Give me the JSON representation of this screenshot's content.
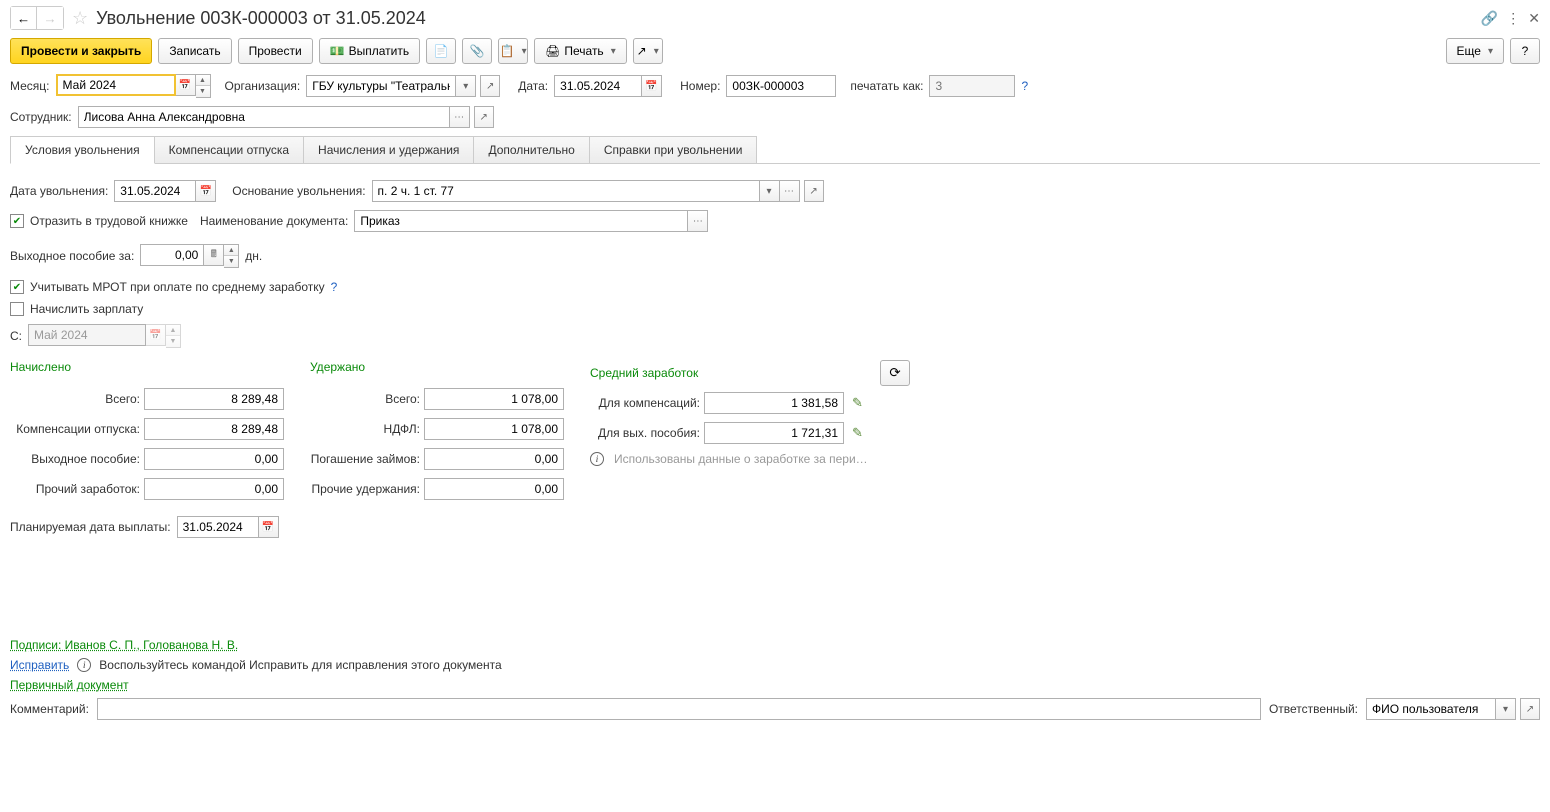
{
  "header": {
    "title": "Увольнение 00ЗК-000003 от 31.05.2024"
  },
  "toolbar": {
    "process_close": "Провести и закрыть",
    "save": "Записать",
    "process": "Провести",
    "pay": "Выплатить",
    "print": "Печать",
    "more": "Еще"
  },
  "fields": {
    "month_label": "Месяц:",
    "month_value": "Май 2024",
    "org_label": "Организация:",
    "org_value": "ГБУ культуры \"Театральны",
    "date_label": "Дата:",
    "date_value": "31.05.2024",
    "number_label": "Номер:",
    "number_value": "00ЗК-000003",
    "print_as_label": "печатать как:",
    "print_as_value": "3",
    "employee_label": "Сотрудник:",
    "employee_value": "Лисова Анна Александровна"
  },
  "tabs": {
    "conditions": "Условия увольнения",
    "vacation_comp": "Компенсации отпуска",
    "accruals": "Начисления и удержания",
    "additional": "Дополнительно",
    "certificates": "Справки при увольнении"
  },
  "conditions": {
    "dismissal_date_label": "Дата увольнения:",
    "dismissal_date_value": "31.05.2024",
    "basis_label": "Основание увольнения:",
    "basis_value": "п. 2 ч. 1 ст. 77",
    "workbook_label": "Отразить в трудовой книжке",
    "doc_name_label": "Наименование документа:",
    "doc_name_value": "Приказ",
    "severance_label": "Выходное пособие за:",
    "severance_value": "0,00",
    "severance_unit": "дн.",
    "mrot_label": "Учитывать МРОТ при оплате по среднему заработку",
    "calc_salary_label": "Начислить зарплату",
    "from_label": "С:",
    "from_value": "Май 2024"
  },
  "sections": {
    "accrued": "Начислено",
    "withheld": "Удержано",
    "avg_earnings": "Средний заработок"
  },
  "accrued": {
    "total_label": "Всего:",
    "total_value": "8 289,48",
    "vacation_label": "Компенсации отпуска:",
    "vacation_value": "8 289,48",
    "severance_label": "Выходное пособие:",
    "severance_value": "0,00",
    "other_label": "Прочий заработок:",
    "other_value": "0,00"
  },
  "withheld": {
    "total_label": "Всего:",
    "total_value": "1 078,00",
    "ndfl_label": "НДФЛ:",
    "ndfl_value": "1 078,00",
    "loans_label": "Погашение займов:",
    "loans_value": "0,00",
    "other_label": "Прочие удержания:",
    "other_value": "0,00"
  },
  "avg": {
    "comp_label": "Для компенсаций:",
    "comp_value": "1 381,58",
    "sev_label": "Для вых. пособия:",
    "sev_value": "1 721,31",
    "info_text": "Использованы данные о заработке за пери…"
  },
  "planned_date_label": "Планируемая дата выплаты:",
  "planned_date_value": "31.05.2024",
  "footer": {
    "signatures": "Подписи: Иванов С. П., Голованова Н. В.",
    "fix": "Исправить",
    "fix_hint": "Воспользуйтесь командой Исправить для исправления этого документа",
    "primary_doc": "Первичный документ",
    "comment_label": "Комментарий:",
    "responsible_label": "Ответственный:",
    "responsible_value": "ФИО пользователя"
  }
}
